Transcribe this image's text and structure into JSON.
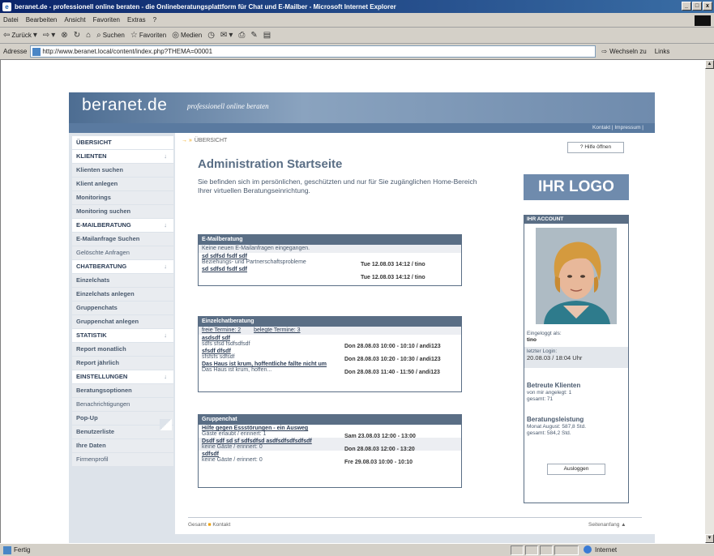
{
  "window": {
    "title": "beranet.de - professionell online beraten - die Onlineberatungsplattform für Chat und E-Mailber - Microsoft Internet Explorer"
  },
  "menu": [
    "Datei",
    "Bearbeiten",
    "Ansicht",
    "Favoriten",
    "Extras",
    "?"
  ],
  "toolbar": {
    "back": "Zurück",
    "search": "Suchen",
    "favorites": "Favoriten",
    "media": "Medien"
  },
  "address": {
    "label": "Adresse",
    "url": "http://www.beranet.local/content/index.php?THEMA=00001",
    "go": "Wechseln zu",
    "links": "Links"
  },
  "status": {
    "text": "Fertig",
    "zone": "Internet"
  },
  "site": {
    "logo": "beranet.de",
    "tagline": "professionell online beraten",
    "top_links": "Kontakt | Impressum |"
  },
  "sidebar": {
    "items": [
      {
        "label": "ÜBERSICHT",
        "type": "cat"
      },
      {
        "label": "KLIENTEN",
        "type": "cat",
        "arrow": "↓"
      },
      {
        "label": "Klienten suchen",
        "type": "sub"
      },
      {
        "label": "Klient anlegen",
        "type": "sub"
      },
      {
        "label": "Monitorings",
        "type": "sub"
      },
      {
        "label": "Monitoring suchen",
        "type": "sub"
      },
      {
        "label": "E-MAILBERATUNG",
        "type": "cat",
        "arrow": "↓"
      },
      {
        "label": "E-Mailanfrage Suchen",
        "type": "sub"
      },
      {
        "label": "Gelöschte Anfragen",
        "type": "plain"
      },
      {
        "label": "CHATBERATUNG",
        "type": "cat",
        "arrow": "↓"
      },
      {
        "label": "Einzelchats",
        "type": "sub"
      },
      {
        "label": "Einzelchats anlegen",
        "type": "sub"
      },
      {
        "label": "Gruppenchats",
        "type": "sub"
      },
      {
        "label": "Gruppenchat anlegen",
        "type": "sub"
      },
      {
        "label": "STATISTIK",
        "type": "cat",
        "arrow": "↓"
      },
      {
        "label": "Report monatlich",
        "type": "sub"
      },
      {
        "label": "Report jährlich",
        "type": "sub"
      },
      {
        "label": "EINSTELLUNGEN",
        "type": "cat",
        "arrow": "↓"
      },
      {
        "label": "Beratungsoptionen",
        "type": "sub"
      },
      {
        "label": "Benachrichtigungen",
        "type": "plain"
      },
      {
        "label": "Pop-Up",
        "type": "sub"
      },
      {
        "label": "Benutzerliste",
        "type": "sub"
      },
      {
        "label": "Ihre Daten",
        "type": "sub"
      },
      {
        "label": "Firmenprofil",
        "type": "plain"
      }
    ]
  },
  "main": {
    "breadcrumb": "ÜBERSICHT",
    "breadcrumb_arrows": "→ »",
    "help_button": "Hilfe öffnen",
    "title": "Administration Startseite",
    "intro": "Sie befinden sich im persönlichen, geschützten und nur für Sie zugänglichen Home-Bereich Ihrer virtuellen Beratungseinrichtung.",
    "email_panel": {
      "header": "E-Mailberatung",
      "notice": "Keine neuen E-Mailanfragen eingegangen.",
      "rows": [
        {
          "subject": "sd sdfsd fsdf sdf",
          "desc": "Beziehungs- und Partnerschaftsprobleme",
          "time": "Tue 12.08.03 14:12 / tino"
        },
        {
          "subject": "sd sdfsd fsdf sdf",
          "desc": "",
          "time": "Tue 12.08.03 14:12 / tino"
        }
      ]
    },
    "single_panel": {
      "header": "Einzelchatberatung",
      "free_label": "freie Termine: 2",
      "booked_label": "belegte Termine: 3",
      "rows": [
        {
          "subject": "asdsdf sdf",
          "desc": "sdfs sfsd fsdfsdfsdf",
          "time": ""
        },
        {
          "subject": "sfsdf dfsdf",
          "desc": "sfsfsfs sdfsdf",
          "time": "Don 28.08.03 10:00 - 10:10 / andi123"
        },
        {
          "subject": "Das Haus ist krum, hoffentliche fallte nicht um",
          "desc": "Das Haus ist krum, hoffen...",
          "time": "Don 28.08.03 10:20 - 10:30 / andi123"
        },
        {
          "subject": "",
          "desc": "",
          "time": "Don 28.08.03 11:40 - 11:50 / andi123"
        }
      ]
    },
    "group_panel": {
      "header": "Gruppenchat",
      "rows": [
        {
          "subject": "Hilfe gegen Essstörungen - ein Ausweg",
          "desc": "Gäste erlaubt / erinnert: 1",
          "time": "Sam 23.08.03 12:00 - 13:00"
        },
        {
          "subject": "Dsdf sdf sd sf sdfsdfsd asdfsdfsdfsdfsdf",
          "desc": "keine Gäste / erinnert: 0",
          "time": "Don 28.08.03 12:00 - 13:20"
        },
        {
          "subject": "sdfsdf",
          "desc": "keine Gäste / erinnert: 0",
          "time": "Fre 29.08.03 10:00 - 10:10"
        }
      ]
    },
    "logo_box": "IHR LOGO",
    "account": {
      "header": "IHR ACCOUNT",
      "logged_in_label": "Eingeloggt als:",
      "logged_in_user": "tino",
      "last_login_label": "letzter Login:",
      "last_login_value": "20.08.03 / 18:04 Uhr",
      "clients_title": "Betreute Klienten",
      "clients_today": "von mir angelegt: 1",
      "clients_total": "gesamt: 71",
      "service_title": "Beratungsleistung",
      "service_month": "Monat August: 587,8 Std.",
      "service_total": "gesamt: 584,2 Std.",
      "logout": "Ausloggen"
    },
    "footer_left_a": "Gesamt",
    "footer_left_b": "Kontakt",
    "footer_right": "Seitenanfang ▲"
  }
}
